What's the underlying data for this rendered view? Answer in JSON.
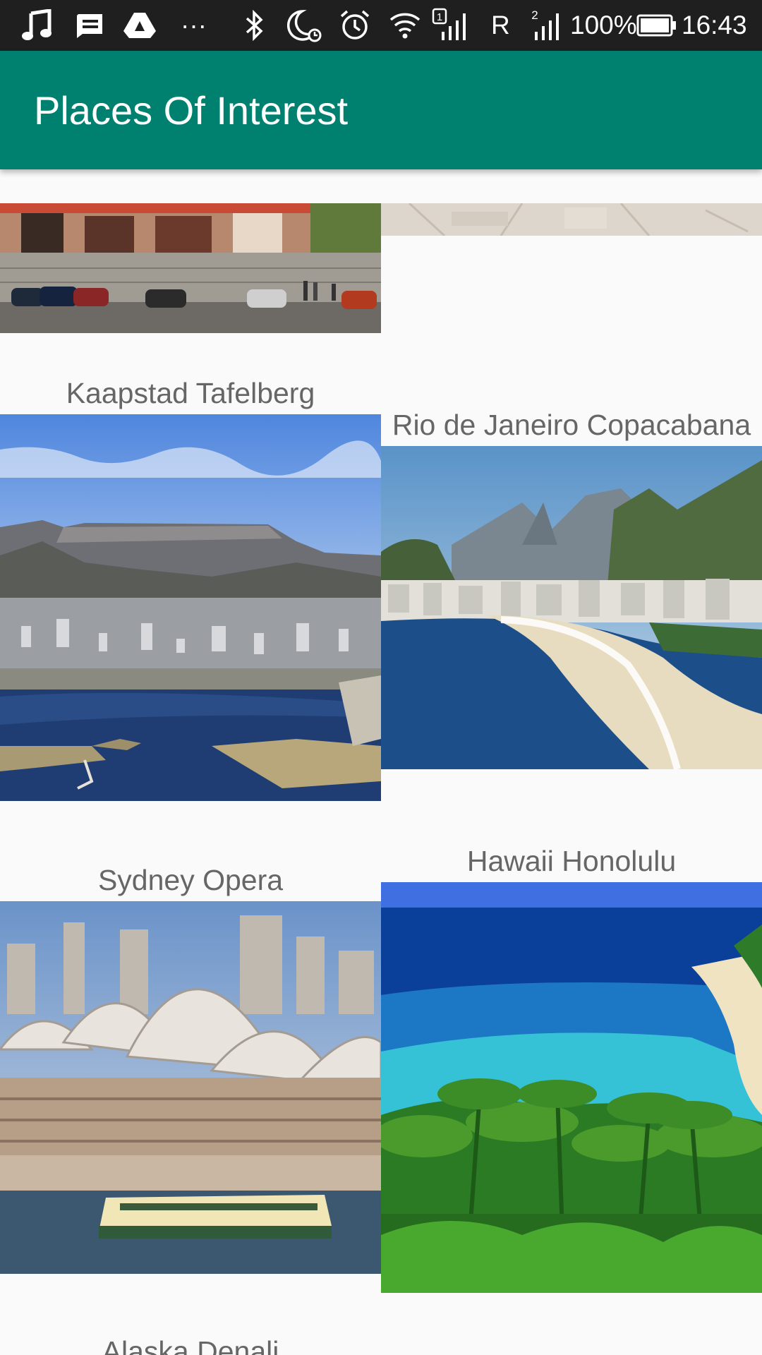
{
  "status_bar": {
    "icons": [
      "music-note-icon",
      "message-icon",
      "drive-icon",
      "more-dots-icon",
      "bluetooth-icon",
      "do-not-disturb-moon-icon",
      "alarm-clock-icon",
      "wifi-icon",
      "sim-1-signal-icon",
      "sim-2-signal-icon",
      "battery-icon"
    ],
    "overflow": "···",
    "sim1_badge": "1",
    "roaming": "R",
    "sim2_badge": "2",
    "battery": "100%",
    "time": "16:43"
  },
  "app_bar": {
    "title": "Places Of Interest",
    "color": "#00806f"
  },
  "places": {
    "items": [
      {
        "label": ""
      },
      {
        "label": ""
      },
      {
        "label": "Kaapstad Tafelberg"
      },
      {
        "label": "Rio de Janeiro Copacabana"
      },
      {
        "label": "Sydney Opera"
      },
      {
        "label": "Hawaii Honolulu"
      },
      {
        "label": "Alaska Denali"
      }
    ]
  }
}
